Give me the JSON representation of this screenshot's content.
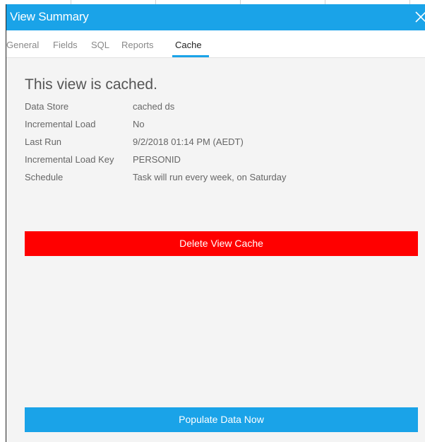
{
  "dialog": {
    "title": "View Summary",
    "close_icon": "close-icon",
    "accent_color": "#1aa3e8",
    "danger_color": "#ff0000"
  },
  "tabs": [
    {
      "label": "General",
      "active": false
    },
    {
      "label": "Fields",
      "active": false
    },
    {
      "label": "SQL",
      "active": false
    },
    {
      "label": "Reports",
      "active": false
    },
    {
      "label": "Cache",
      "active": true
    }
  ],
  "cache": {
    "heading": "This view is cached.",
    "rows": [
      {
        "key": "Data Store",
        "value": "cached ds"
      },
      {
        "key": "Incremental Load",
        "value": "No"
      },
      {
        "key": "Last Run",
        "value": "9/2/2018 01:14 PM (AEDT)"
      },
      {
        "key": "Incremental Load Key",
        "value": "PERSONID"
      },
      {
        "key": "Schedule",
        "value": "Task will run every week, on Saturday"
      }
    ],
    "delete_label": "Delete View Cache",
    "populate_label": "Populate Data Now"
  }
}
